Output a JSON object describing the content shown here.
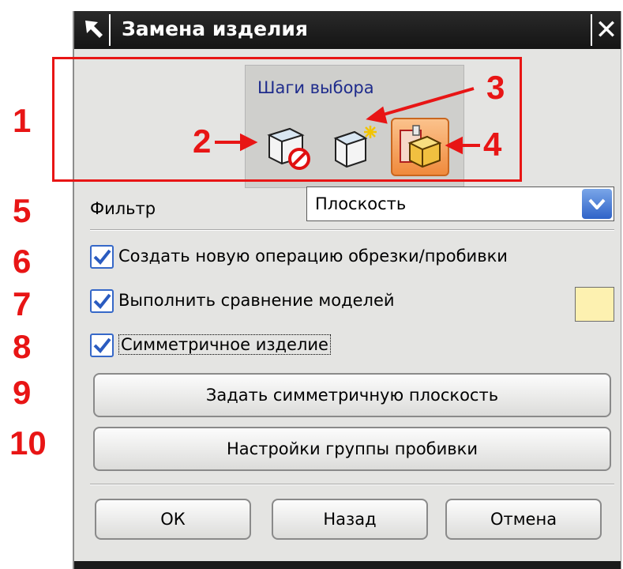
{
  "window": {
    "title": "Замена изделия",
    "close_glyph": "✕"
  },
  "selection_steps": {
    "label": "Шаги выбора"
  },
  "filter": {
    "label": "Фильтр",
    "value": "Плоскость"
  },
  "options": [
    {
      "label": "Создать новую операцию обрезки/пробивки",
      "checked": true
    },
    {
      "label": "Выполнить сравнение моделей",
      "checked": true
    },
    {
      "label": "Симметричное изделие",
      "checked": true
    }
  ],
  "comparison_color": "#fdf1b0",
  "buttons": {
    "symmetric_plane": "Задать симметричную плоскость",
    "punch_group_settings": "Настройки группы пробивки",
    "ok": "ОК",
    "back": "Назад",
    "cancel": "Отмена"
  },
  "annotations": [
    "1",
    "2",
    "3",
    "4",
    "5",
    "6",
    "7",
    "8",
    "9",
    "10"
  ],
  "colors": {
    "annotation": "#e81515",
    "titlebar": "#1a1a1a",
    "dialog_bg": "#e4e4e2",
    "accent": "#3668c8"
  }
}
